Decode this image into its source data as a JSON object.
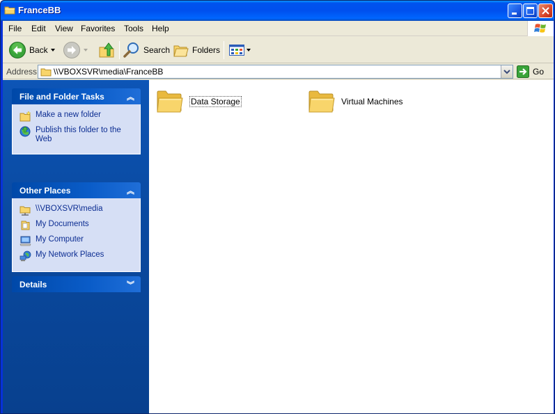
{
  "window": {
    "title": "FranceBB"
  },
  "menu": [
    "File",
    "Edit",
    "View",
    "Favorites",
    "Tools",
    "Help"
  ],
  "toolbar": {
    "back_label": "Back",
    "search_label": "Search",
    "folders_label": "Folders"
  },
  "address": {
    "label": "Address",
    "value": "\\\\VBOXSVR\\media\\FranceBB",
    "go_label": "Go"
  },
  "sidebar": {
    "file_tasks": {
      "title": "File and Folder Tasks",
      "items": [
        {
          "label": "Make a new folder",
          "icon": "new-folder-icon"
        },
        {
          "label": "Publish this folder to the Web",
          "icon": "publish-web-icon"
        }
      ]
    },
    "other_places": {
      "title": "Other Places",
      "items": [
        {
          "label": "\\\\VBOXSVR\\media",
          "icon": "network-folder-icon"
        },
        {
          "label": "My Documents",
          "icon": "my-documents-icon"
        },
        {
          "label": "My Computer",
          "icon": "my-computer-icon"
        },
        {
          "label": "My Network Places",
          "icon": "network-places-icon"
        }
      ]
    },
    "details": {
      "title": "Details"
    }
  },
  "files": [
    {
      "name": "Data Storage",
      "selected": true
    },
    {
      "name": "Virtual Machines",
      "selected": false
    }
  ],
  "colors": {
    "title_bar": "#0050ee",
    "side_pane": "#0a4aa1",
    "panel_body": "#d6dff5",
    "link_text": "#0c2d92",
    "folder_yellow": "#f8d56b"
  }
}
